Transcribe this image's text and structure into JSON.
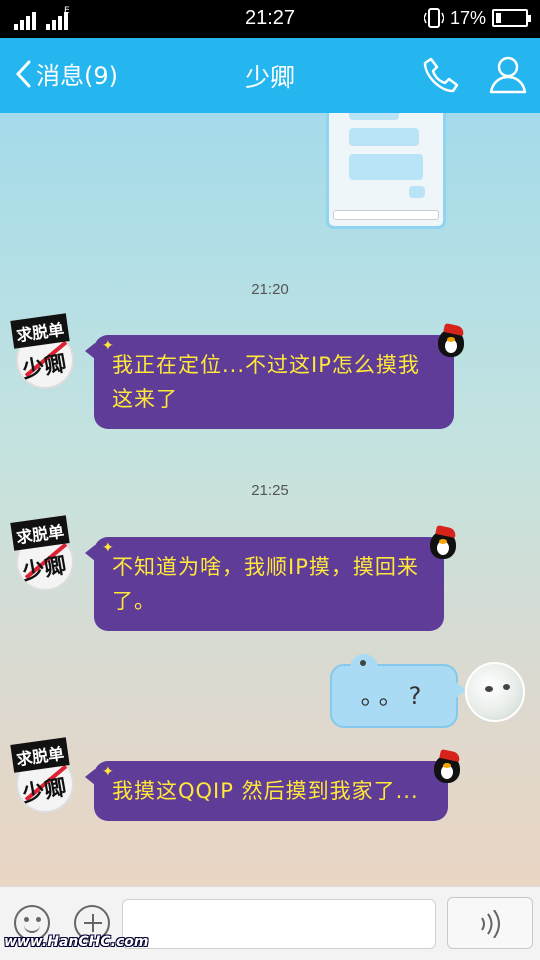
{
  "status_bar": {
    "time": "21:27",
    "battery_percent_label": "17%",
    "battery_level": 0.17,
    "network_label": "E"
  },
  "header": {
    "back_label": "消息(9)",
    "title": "少卿"
  },
  "messages": [
    {
      "type": "timestamp",
      "text": "21:20"
    },
    {
      "type": "incoming",
      "text": "我正在定位...不过这IP怎么摸我这来了"
    },
    {
      "type": "timestamp",
      "text": "21:25"
    },
    {
      "type": "incoming",
      "text": "不知道为啥，我顺IP摸，摸回来了。"
    },
    {
      "type": "outgoing",
      "text": "。。?"
    },
    {
      "type": "incoming",
      "text": "我摸这QQIP 然后摸到我家了..."
    }
  ],
  "contact_avatar": {
    "tag_text": "求脱单",
    "name_text": "少卿"
  },
  "input_bar": {
    "placeholder": "",
    "watermark": "www.HanCHC.com"
  },
  "colors": {
    "header": "#25b6ef",
    "incoming_bubble": "#5e3c97",
    "incoming_text": "#ffe83a",
    "outgoing_bubble": "#a9dcf4"
  },
  "icons": {
    "back": "chevron-left-icon",
    "call": "phone-icon",
    "profile": "person-icon",
    "emoji": "smiley-icon",
    "plus": "plus-icon",
    "voice": "voice-wave-icon"
  }
}
